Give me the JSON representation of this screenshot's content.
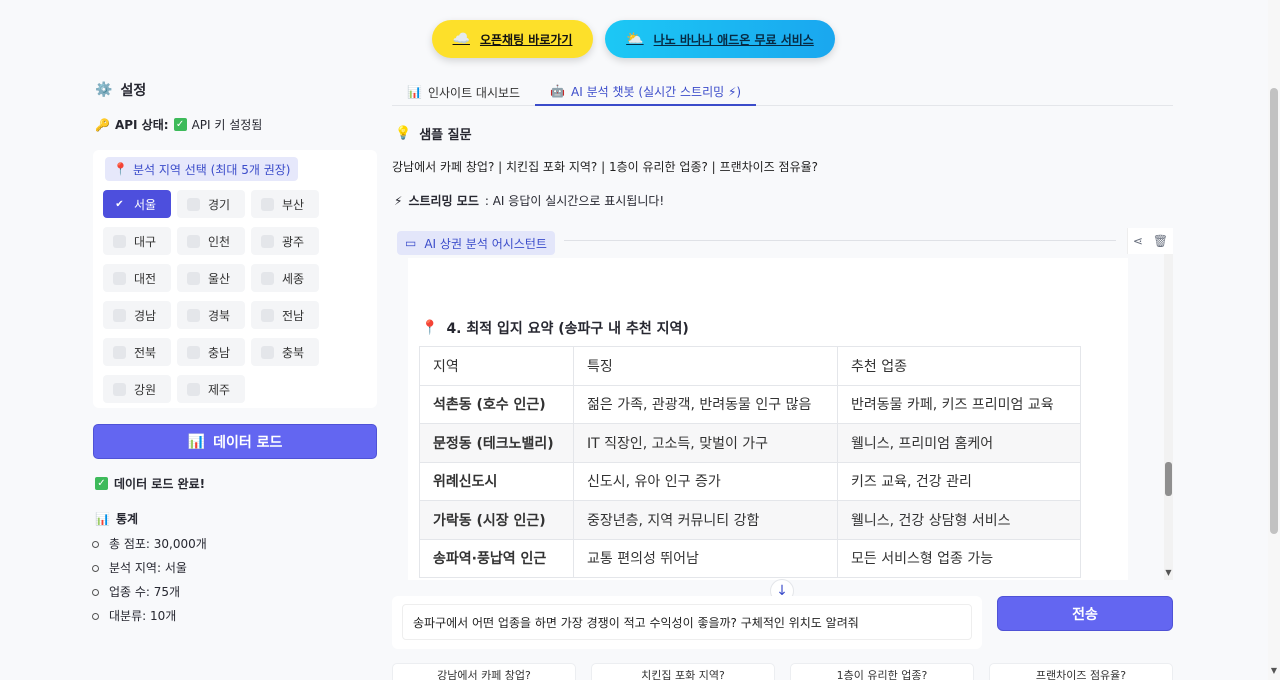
{
  "promo": {
    "openchat": {
      "icon": "☁️",
      "label": "오픈채팅 바로가기"
    },
    "nano": {
      "icon": "⛅",
      "label": "나노 바나나 애드온 무료 서비스"
    }
  },
  "sidebar": {
    "title_icon": "⚙️",
    "title": "설정",
    "api_label": "API 상태:",
    "api_value": "API 키 설정됨",
    "region_label": "분석 지역 선택 (최대 5개 권장)",
    "regions": [
      {
        "name": "서울",
        "checked": true
      },
      {
        "name": "경기",
        "checked": false
      },
      {
        "name": "부산",
        "checked": false
      },
      {
        "name": "대구",
        "checked": false
      },
      {
        "name": "인천",
        "checked": false
      },
      {
        "name": "광주",
        "checked": false
      },
      {
        "name": "대전",
        "checked": false
      },
      {
        "name": "울산",
        "checked": false
      },
      {
        "name": "세종",
        "checked": false
      },
      {
        "name": "경남",
        "checked": false
      },
      {
        "name": "경북",
        "checked": false
      },
      {
        "name": "전남",
        "checked": false
      },
      {
        "name": "전북",
        "checked": false
      },
      {
        "name": "충남",
        "checked": false
      },
      {
        "name": "충북",
        "checked": false
      },
      {
        "name": "강원",
        "checked": false
      },
      {
        "name": "제주",
        "checked": false
      }
    ],
    "load_button": "데이터 로드",
    "load_done": "데이터 로드 완료!",
    "stats_title": "통계",
    "stats": [
      "총 점포: 30,000개",
      "분석 지역: 서울",
      "업종 수: 75개",
      "대분류: 10개"
    ]
  },
  "tabs": [
    {
      "icon": "📊",
      "label": "인사이트 대시보드"
    },
    {
      "icon": "🤖",
      "label": "AI 분석 챗봇 (실시간 스트리밍 ⚡)"
    }
  ],
  "main": {
    "sample_title": "샘플 질문",
    "sample_text": "강남에서 카페 창업? | 치킨집 포화 지역? | 1층이 유리한 업종? | 프랜차이즈 점유율?",
    "stream_label": "스트리밍 모드",
    "stream_text": ": AI 응답이 실시간으로 표시됩니다!",
    "assistant_tag": "AI 상권 분석 어시스턴트",
    "section_title": "4. 최적 입지 요약 (송파구 내 추천 지역)",
    "table": {
      "headers": [
        "지역",
        "특징",
        "추천 업종"
      ],
      "rows": [
        [
          "석촌동 (호수 인근)",
          "젊은 가족, 관광객, 반려동물 인구 많음",
          "반려동물 카페, 키즈 프리미엄 교육"
        ],
        [
          "문정동 (테크노밸리)",
          "IT 직장인, 고소득, 맞벌이 가구",
          "웰니스, 프리미엄 홈케어"
        ],
        [
          "위례신도시",
          "신도시, 유아 인구 증가",
          "키즈 교육, 건강 관리"
        ],
        [
          "가락동 (시장 인근)",
          "중장년층, 지역 커뮤니티 강함",
          "웰니스, 건강 상담형 서비스"
        ],
        [
          "송파역·풍납역 인근",
          "교통 편의성 뛰어남",
          "모든 서비스형 업종 가능"
        ]
      ]
    },
    "input_value": "송파구에서 어떤 업종을 하면 가장 경쟁이 적고 수익성이 좋을까? 구체적인 위치도 알려줘",
    "send_button": "전송",
    "quick": [
      "강남에서 카페 창업?",
      "치킨집 포화 지역?",
      "1층이 유리한 업종?",
      "프랜차이즈 점유율?"
    ]
  }
}
